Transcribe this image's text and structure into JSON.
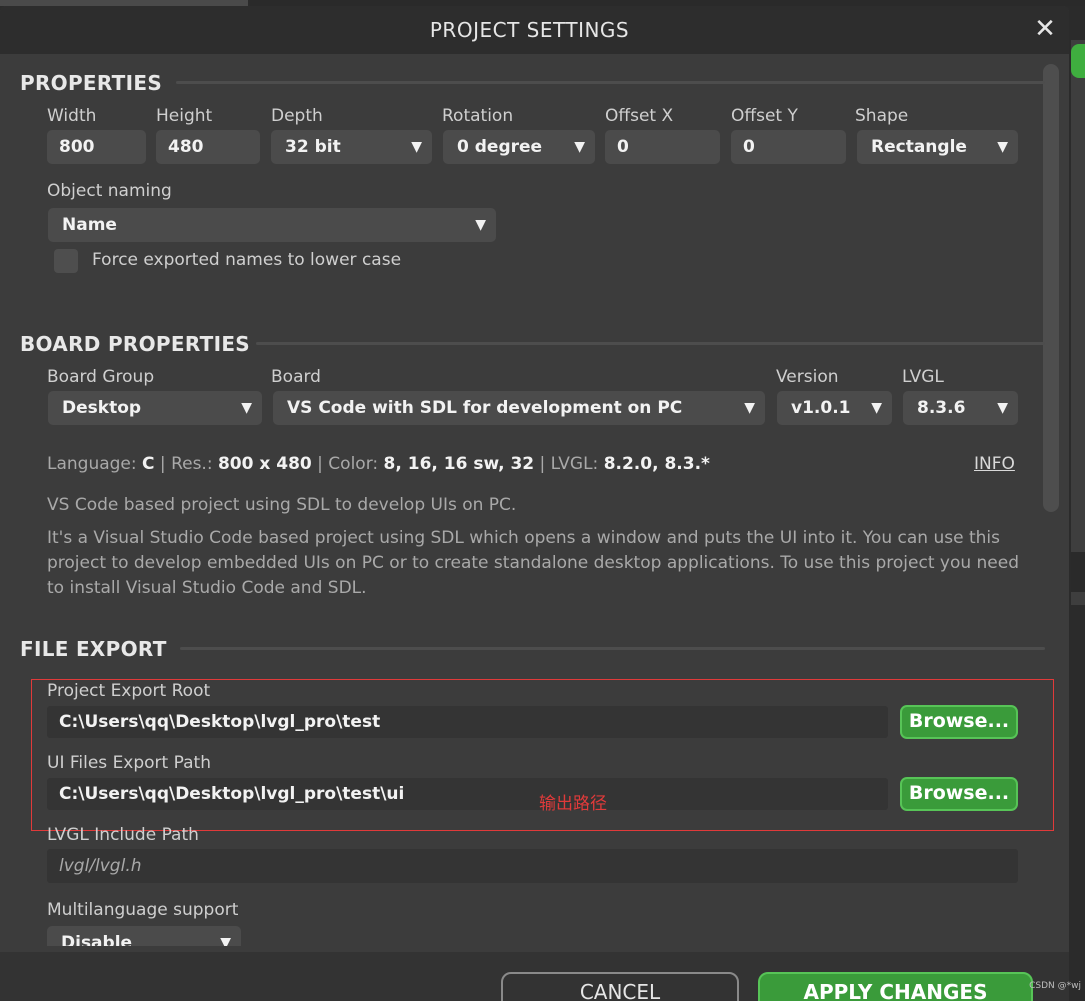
{
  "dialog": {
    "title": "PROJECT SETTINGS",
    "close_icon": "close-icon"
  },
  "properties": {
    "heading": "PROPERTIES",
    "width": {
      "label": "Width",
      "value": "800"
    },
    "height": {
      "label": "Height",
      "value": "480"
    },
    "depth": {
      "label": "Depth",
      "value": "32 bit"
    },
    "rotation": {
      "label": "Rotation",
      "value": "0 degree"
    },
    "offset_x": {
      "label": "Offset X",
      "value": "0"
    },
    "offset_y": {
      "label": "Offset Y",
      "value": "0"
    },
    "shape": {
      "label": "Shape",
      "value": "Rectangle"
    },
    "object_naming": {
      "label": "Object naming",
      "value": "Name"
    },
    "force_lower": {
      "label": "Force exported names to lower case",
      "checked": false
    }
  },
  "board": {
    "heading": "BOARD PROPERTIES",
    "group": {
      "label": "Board Group",
      "value": "Desktop"
    },
    "board": {
      "label": "Board",
      "value": "VS Code with SDL for development on PC"
    },
    "version": {
      "label": "Version",
      "value": "v1.0.1"
    },
    "lvgl": {
      "label": "LVGL",
      "value": "8.3.6"
    },
    "info": {
      "language_label": "Language:",
      "language": "C",
      "res_label": "Res.:",
      "res": "800 x 480",
      "color_label": "Color:",
      "color": "8, 16, 16 sw, 32",
      "lvgl_label": "LVGL:",
      "lvgl": "8.2.0, 8.3.*",
      "sep": "|",
      "link": "INFO"
    },
    "summary": "VS Code based project using SDL to develop UIs on PC.",
    "description": "It's a Visual Studio Code based project using SDL which opens a window and puts the UI into it. You can use this project to develop embedded UIs on PC or to create standalone desktop applications. To use this project you need to install Visual Studio Code and SDL."
  },
  "file_export": {
    "heading": "FILE EXPORT",
    "export_root": {
      "label": "Project Export Root",
      "value": "C:\\Users\\qq\\Desktop\\lvgl_pro\\test"
    },
    "ui_path": {
      "label": "UI Files Export Path",
      "value": "C:\\Users\\qq\\Desktop\\lvgl_pro\\test\\ui"
    },
    "browse_label": "Browse...",
    "annotation": "输出路径",
    "include": {
      "label": "LVGL Include Path",
      "placeholder": "lvgl/lvgl.h"
    },
    "multilanguage": {
      "label": "Multilanguage support",
      "value": "Disable"
    }
  },
  "footer": {
    "cancel": "CANCEL",
    "apply": "APPLY CHANGES",
    "watermark": "CSDN @*wj"
  },
  "colors": {
    "accent": "#3a9b3a",
    "annotation": "#e03a3a",
    "background": "#3c3c3c"
  }
}
